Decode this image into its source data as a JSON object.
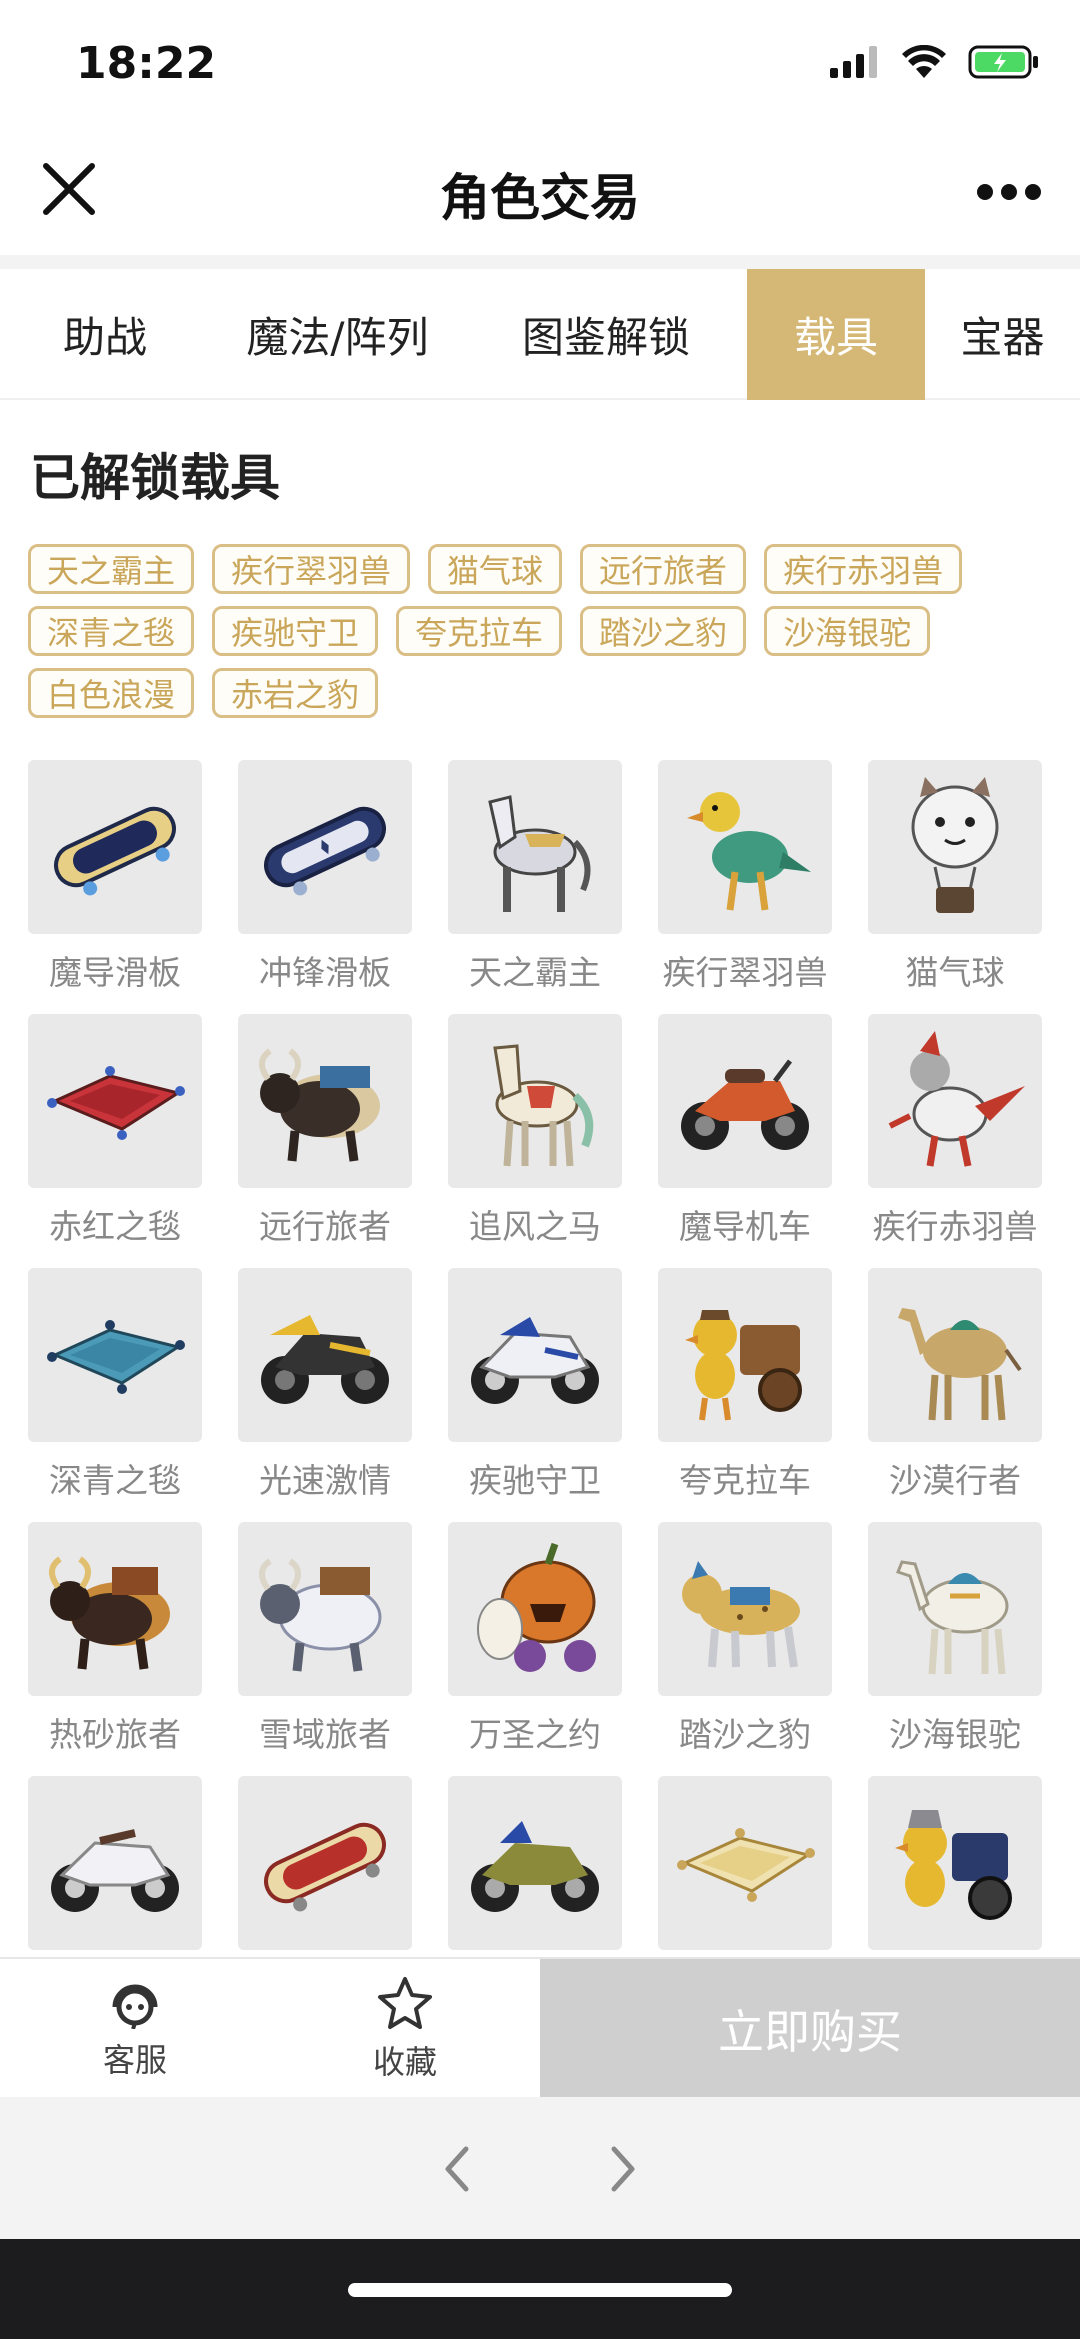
{
  "status": {
    "time": "18:22"
  },
  "nav": {
    "title": "角色交易"
  },
  "tabs": [
    {
      "label": "助战"
    },
    {
      "label": "魔法/阵列"
    },
    {
      "label": "图鉴解锁"
    },
    {
      "label": "载具",
      "active": true
    },
    {
      "label": "宝器"
    }
  ],
  "section": {
    "title": "已解锁载具"
  },
  "tags": [
    "天之霸主",
    "疾行翠羽兽",
    "猫气球",
    "远行旅者",
    "疾行赤羽兽",
    "深青之毯",
    "疾驰守卫",
    "夸克拉车",
    "踏沙之豹",
    "沙海银驼",
    "白色浪漫",
    "赤岩之豹"
  ],
  "vehicles": [
    {
      "name": "魔导滑板",
      "icon": "skateboard-icon"
    },
    {
      "name": "冲锋滑板",
      "icon": "skateboard-icon"
    },
    {
      "name": "天之霸主",
      "icon": "horse-icon"
    },
    {
      "name": "疾行翠羽兽",
      "icon": "bird-icon"
    },
    {
      "name": "猫气球",
      "icon": "balloon-icon"
    },
    {
      "name": "赤红之毯",
      "icon": "carpet-icon"
    },
    {
      "name": "远行旅者",
      "icon": "yak-icon"
    },
    {
      "name": "追风之马",
      "icon": "horse-icon"
    },
    {
      "name": "魔导机车",
      "icon": "motorcycle-icon"
    },
    {
      "name": "疾行赤羽兽",
      "icon": "bird-icon"
    },
    {
      "name": "深青之毯",
      "icon": "carpet-icon"
    },
    {
      "name": "光速激情",
      "icon": "motorcycle-icon"
    },
    {
      "name": "疾驰守卫",
      "icon": "motorcycle-icon"
    },
    {
      "name": "夸克拉车",
      "icon": "cart-icon"
    },
    {
      "name": "沙漠行者",
      "icon": "camel-icon"
    },
    {
      "name": "热砂旅者",
      "icon": "yak-icon"
    },
    {
      "name": "雪域旅者",
      "icon": "yak-icon"
    },
    {
      "name": "万圣之约",
      "icon": "pumpkin-icon"
    },
    {
      "name": "踏沙之豹",
      "icon": "leopard-icon"
    },
    {
      "name": "沙海银驼",
      "icon": "camel-icon"
    },
    {
      "name": "",
      "icon": "motorcycle-icon"
    },
    {
      "name": "",
      "icon": "skateboard-icon"
    },
    {
      "name": "",
      "icon": "motorcycle-icon"
    },
    {
      "name": "",
      "icon": "carpet-icon"
    },
    {
      "name": "",
      "icon": "cart-icon"
    }
  ],
  "bottom": {
    "service_label": "客服",
    "favorite_label": "收藏",
    "buy_label": "立即购买"
  },
  "colors": {
    "accent": "#d5b776",
    "tag_border": "#d9bf86",
    "tag_text": "#c9a65a",
    "buy_disabled": "#cfcfcf"
  }
}
